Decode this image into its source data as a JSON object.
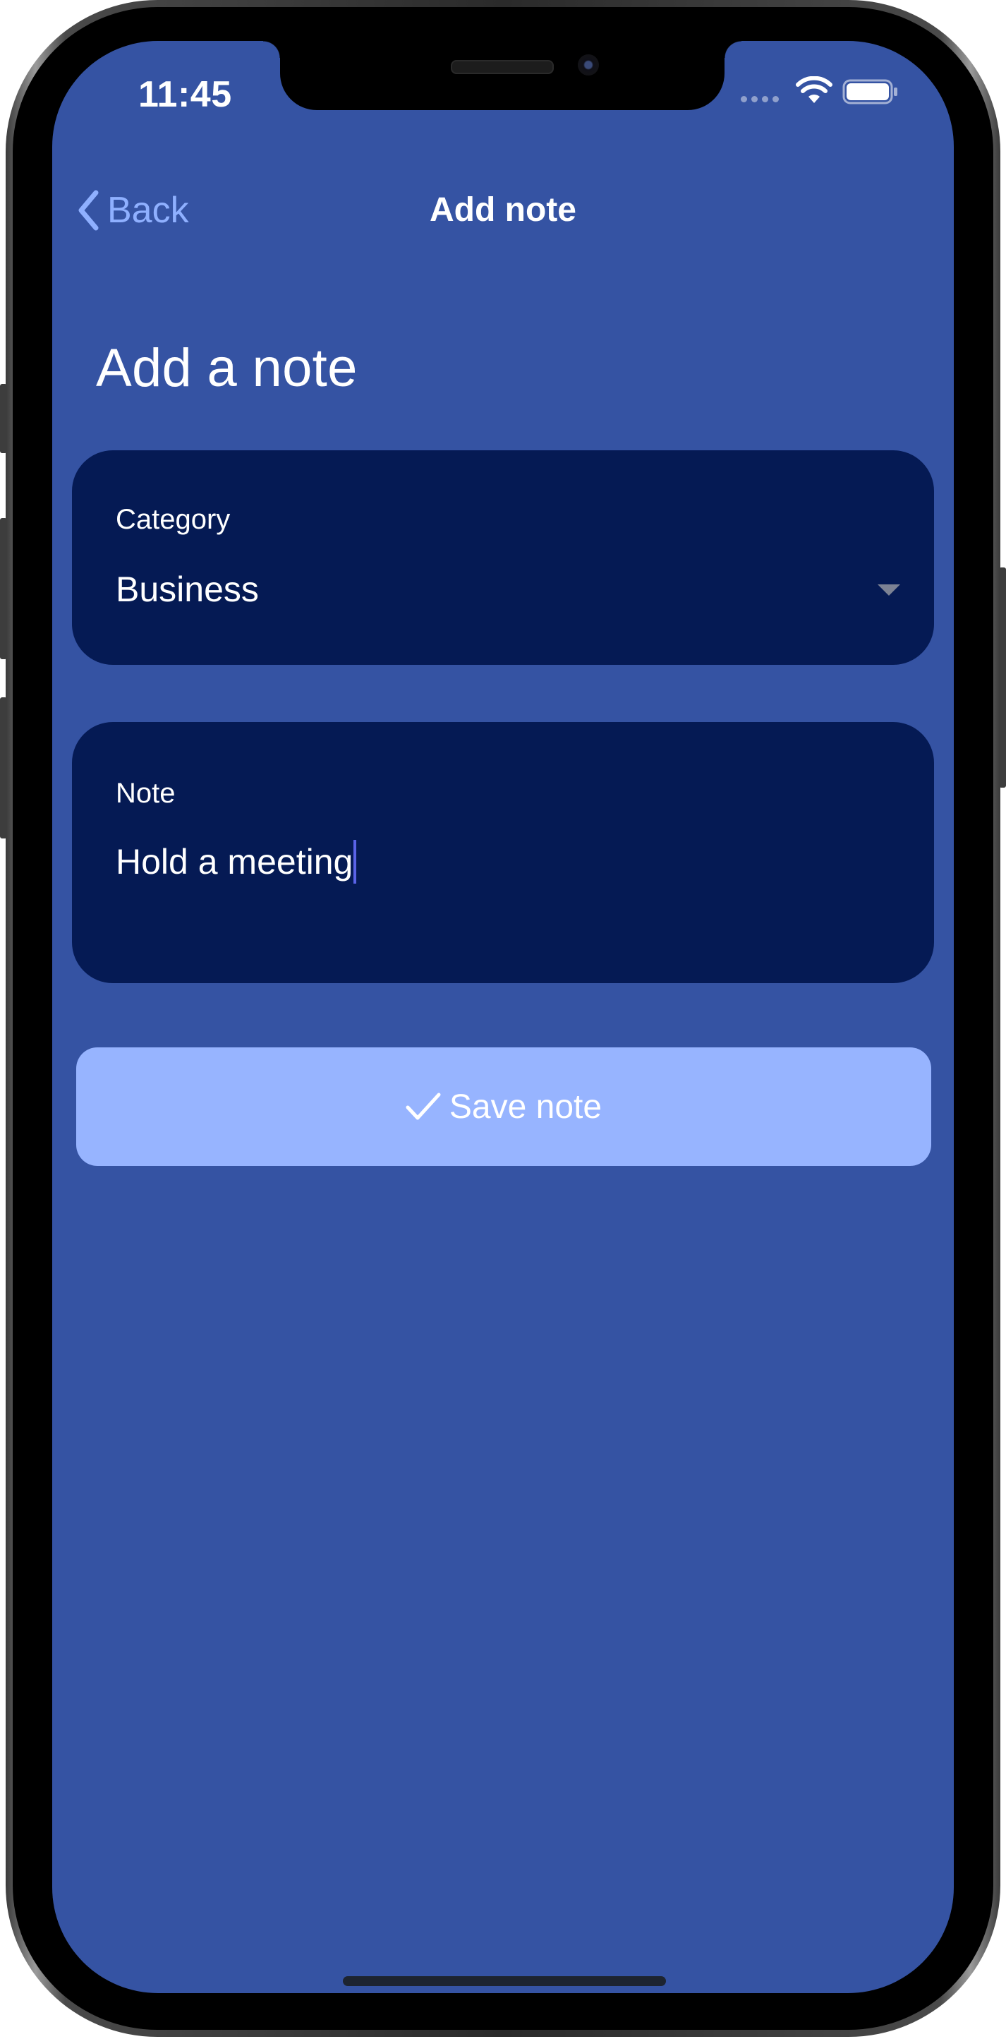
{
  "status_bar": {
    "time": "11:45",
    "wifi_icon": "wifi-icon",
    "battery_icon": "battery-icon",
    "signal_icon": "signal-dots-icon"
  },
  "nav": {
    "back_label": "Back",
    "title": "Add note"
  },
  "page": {
    "title": "Add a note"
  },
  "category_field": {
    "label": "Category",
    "value": "Business"
  },
  "note_field": {
    "label": "Note",
    "value": "Hold a meeting"
  },
  "save_button": {
    "label": "Save note",
    "icon": "checkmark-icon"
  },
  "colors": {
    "background": "#3553a3",
    "field_background": "#051a54",
    "accent": "#8fb0ff",
    "button_background": "#97b4ff",
    "caret": "#5a63e8"
  }
}
